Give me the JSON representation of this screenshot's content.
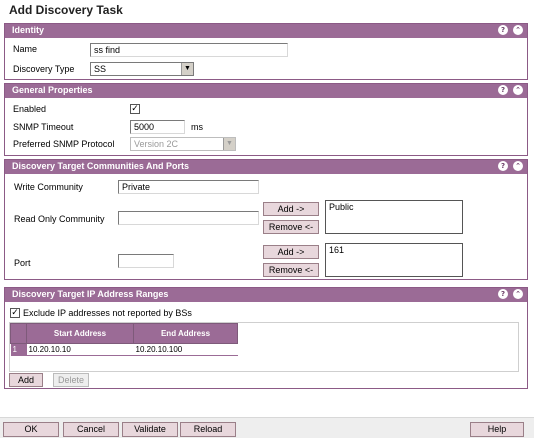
{
  "page": {
    "title": "Add Discovery Task"
  },
  "identity": {
    "header": "Identity",
    "name_label": "Name",
    "name_value": "ss find",
    "type_label": "Discovery Type",
    "type_value": "SS"
  },
  "general": {
    "header": "General Properties",
    "enabled_label": "Enabled",
    "enabled_checked": true,
    "snmp_timeout_label": "SNMP Timeout",
    "snmp_timeout_value": "5000",
    "snmp_timeout_unit": "ms",
    "snmp_protocol_label": "Preferred SNMP Protocol",
    "snmp_protocol_value": "Version 2C"
  },
  "targets": {
    "header": "Discovery Target Communities And Ports",
    "write_label": "Write Community",
    "write_value": "Private",
    "read_label": "Read Only Community",
    "read_value": "",
    "read_list": [
      "Public"
    ],
    "port_label": "Port",
    "port_value": "",
    "port_list": [
      "161"
    ],
    "add_label": "Add ->",
    "remove_label": "Remove <-"
  },
  "ranges": {
    "header": "Discovery Target IP Address Ranges",
    "exclude_label": "Exclude IP addresses not reported by BSs",
    "exclude_checked": true,
    "columns": [
      "Start Address",
      "End Address"
    ],
    "rows": [
      {
        "num": "1",
        "start": "10.20.10.10",
        "end": "10.20.10.100"
      }
    ],
    "add_label": "Add",
    "delete_label": "Delete"
  },
  "footer": {
    "ok": "OK",
    "cancel": "Cancel",
    "validate": "Validate",
    "reload": "Reload",
    "help": "Help"
  },
  "icons": {
    "help": "help-icon",
    "collapse": "collapse-icon"
  },
  "colors": {
    "panel_header": "#9b6b96",
    "button_bg": "#e8d7dc"
  }
}
